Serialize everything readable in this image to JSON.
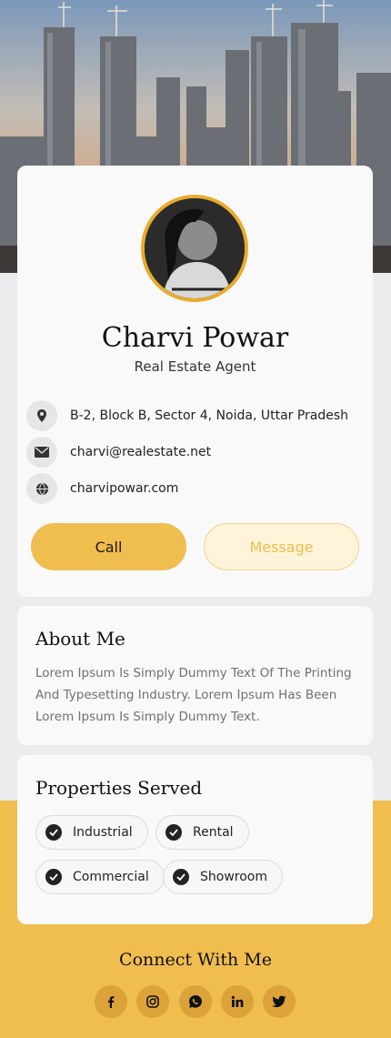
{
  "profile": {
    "name": "Charvi Powar",
    "role": "Real Estate Agent"
  },
  "contacts": [
    {
      "icon": "location-pin-icon",
      "text": "B-2, Block B, Sector 4, Noida, Uttar Pradesh"
    },
    {
      "icon": "mail-icon",
      "text": "charvi@realestate.net"
    },
    {
      "icon": "globe-icon",
      "text": "charvipowar.com"
    }
  ],
  "actions": {
    "call_label": "Call",
    "message_label": "Message"
  },
  "about": {
    "title": "About Me",
    "text": "Lorem Ipsum Is Simply Dummy Text Of The Printing And Typesetting Industry. Lorem Ipsum Has Been Lorem Ipsum Is Simply Dummy Text."
  },
  "properties": {
    "title": "Properties Served",
    "items": [
      "Industrial",
      "Rental",
      "Commercial",
      "Showroom"
    ]
  },
  "connect": {
    "title": "Connect With Me",
    "socials": [
      "facebook-icon",
      "instagram-icon",
      "whatsapp-icon",
      "linkedin-icon",
      "twitter-icon"
    ]
  },
  "colors": {
    "accent": "#f0bd4f",
    "accent_light": "#fff3d9",
    "avatar_ring": "#e8ac2c"
  }
}
